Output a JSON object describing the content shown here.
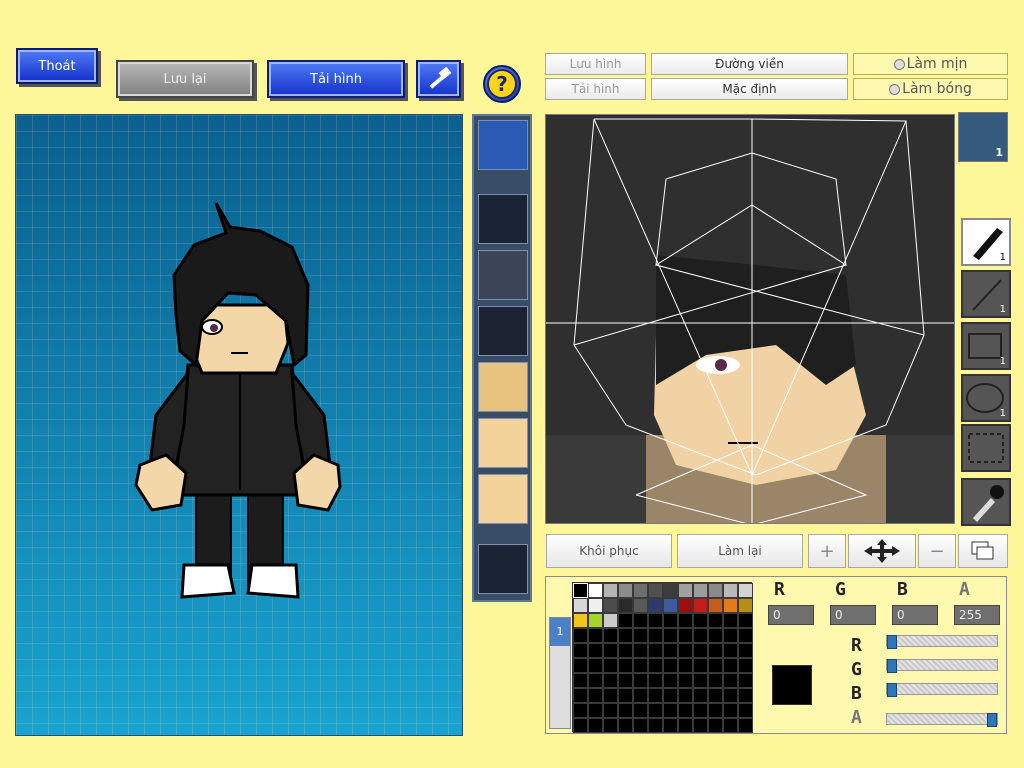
{
  "toolbar": {
    "exit_label": "Thoát",
    "save_label": "Lưu lại",
    "load_label": "Tải hình",
    "help_symbol": "?",
    "hammer_icon": "hammer-icon"
  },
  "editor_tabs": {
    "save_image": "Lưu hình",
    "load_image": "Tải hình",
    "outline": "Đường viền",
    "default": "Mặc định",
    "smooth": "Làm mịn",
    "shade": "Làm bóng"
  },
  "parts": {
    "thumb_count": "1",
    "items": [
      "mask",
      "empty",
      "dragon-head",
      "suit",
      "eyes",
      "nose",
      "mouth",
      "empty"
    ]
  },
  "tools": [
    {
      "name": "pen",
      "count": "1"
    },
    {
      "name": "line",
      "count": "1"
    },
    {
      "name": "rectangle",
      "count": "1"
    },
    {
      "name": "ellipse",
      "count": "1"
    },
    {
      "name": "selection",
      "count": ""
    },
    {
      "name": "eyedropper",
      "count": ""
    }
  ],
  "actions": {
    "restore": "Khôi phục",
    "redo": "Làm lại"
  },
  "color": {
    "r_label": "R",
    "g_label": "G",
    "b_label": "B",
    "a_label": "A",
    "r": "0",
    "g": "0",
    "b": "0",
    "a": "255",
    "current": "#000000",
    "slider_r": 0,
    "slider_g": 0,
    "slider_b": 0,
    "slider_a": 1,
    "palette_row1": [
      "#000000",
      "#ffffff",
      "#b4b4b4",
      "#8c8c8c",
      "#6e6e6e",
      "#505050",
      "#3c3c3c",
      "#a0a0a0",
      "#9c9c9c",
      "#8a8a8a",
      "#b9b9b9",
      "#d3d3d3"
    ],
    "palette_row2": [
      "#d7d7d7",
      "#f0f0f0",
      "#4c4c4c",
      "#2a2a2a",
      "#5a5a5a",
      "#2f3b6a",
      "#3e5a9a",
      "#a00f0f",
      "#c41b1b",
      "#c95c1c",
      "#e47b19",
      "#b88f16"
    ],
    "palette_row3": [
      "#f2c51d",
      "#a6d52a",
      "#cccccc"
    ],
    "layer_index": "1"
  }
}
